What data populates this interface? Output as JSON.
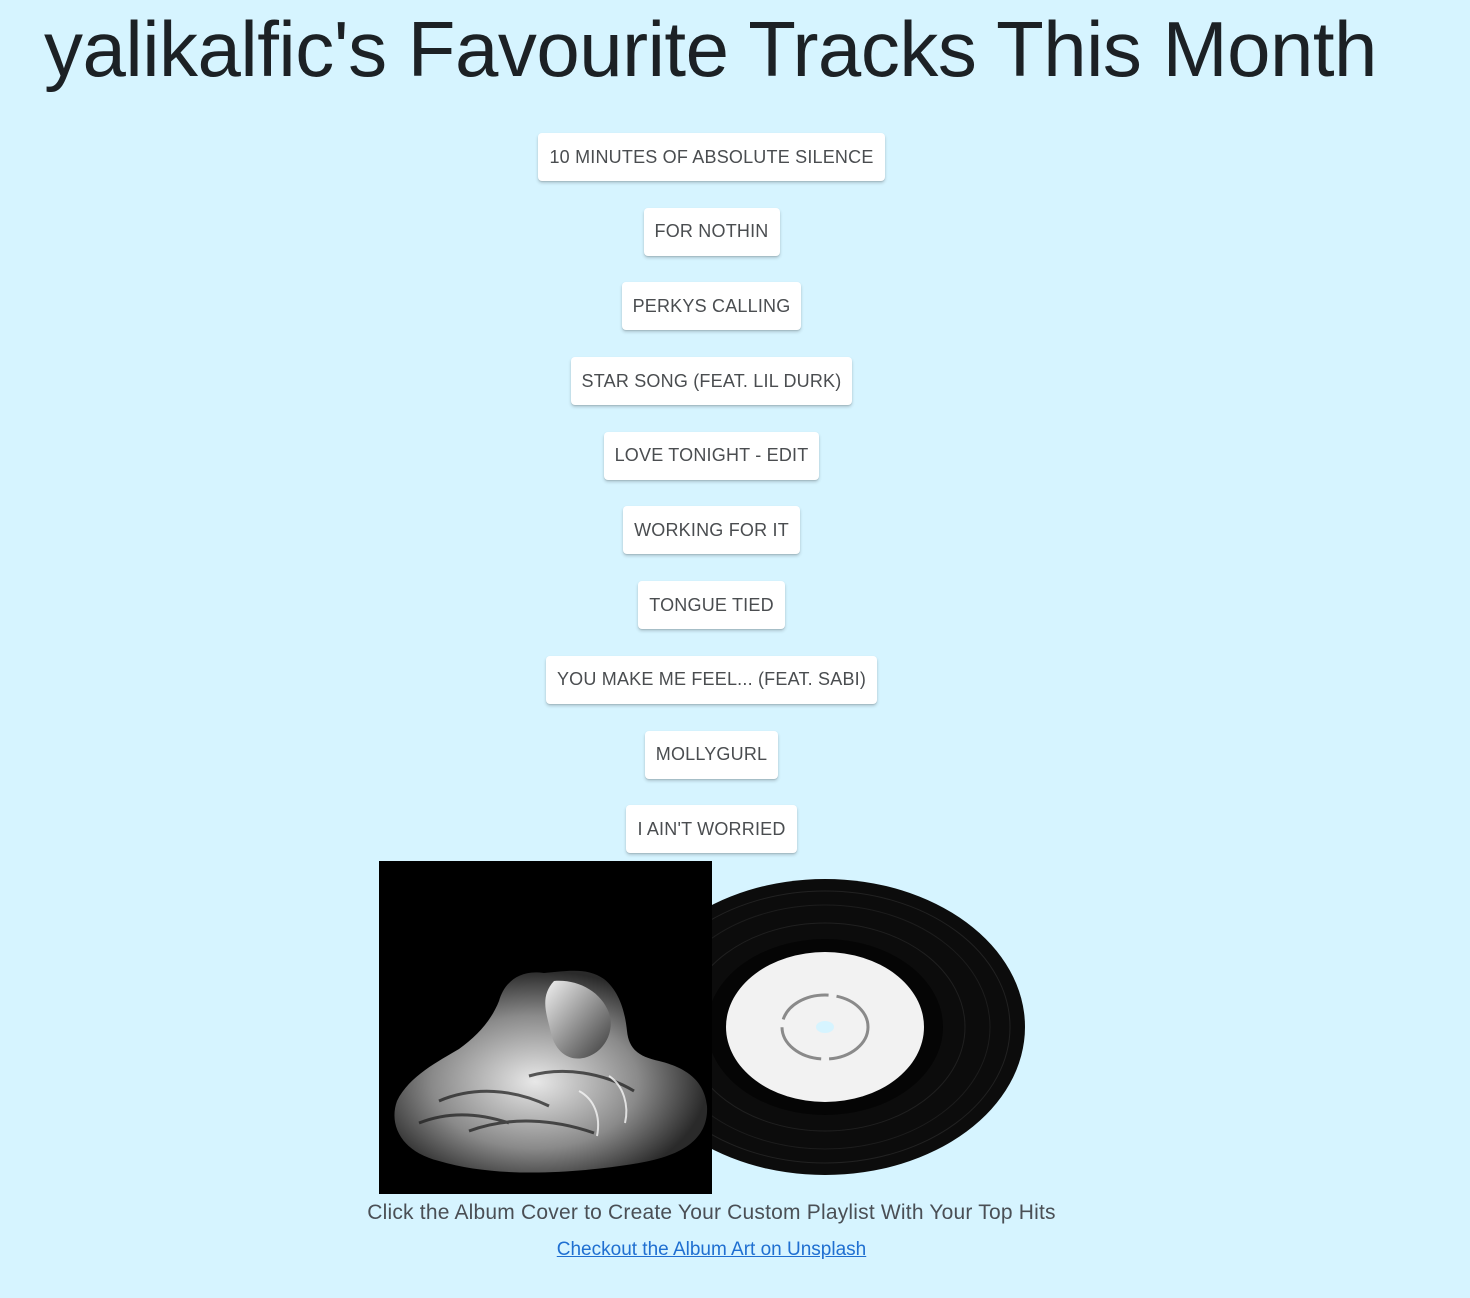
{
  "page": {
    "title": "yalikalfic's Favourite Tracks This Month"
  },
  "tracks": [
    "10 MINUTES OF ABSOLUTE SILENCE",
    "FOR NOTHIN",
    "PERKYS CALLING",
    "STAR SONG (FEAT. LIL DURK)",
    "LOVE TONIGHT - EDIT",
    "WORKING FOR IT",
    "TONGUE TIED",
    "YOU MAKE ME FEEL... (FEAT. SABI)",
    "MOLLYGURL",
    "I AIN'T WORRIED"
  ],
  "album": {
    "caption": "Click the Album Cover to Create Your Custom Playlist With Your Top Hits",
    "link_text": "Checkout the Album Art on Unsplash"
  },
  "colors": {
    "background": "#d6f4ff",
    "button_bg": "#ffffff",
    "link": "#1f6fd1"
  }
}
